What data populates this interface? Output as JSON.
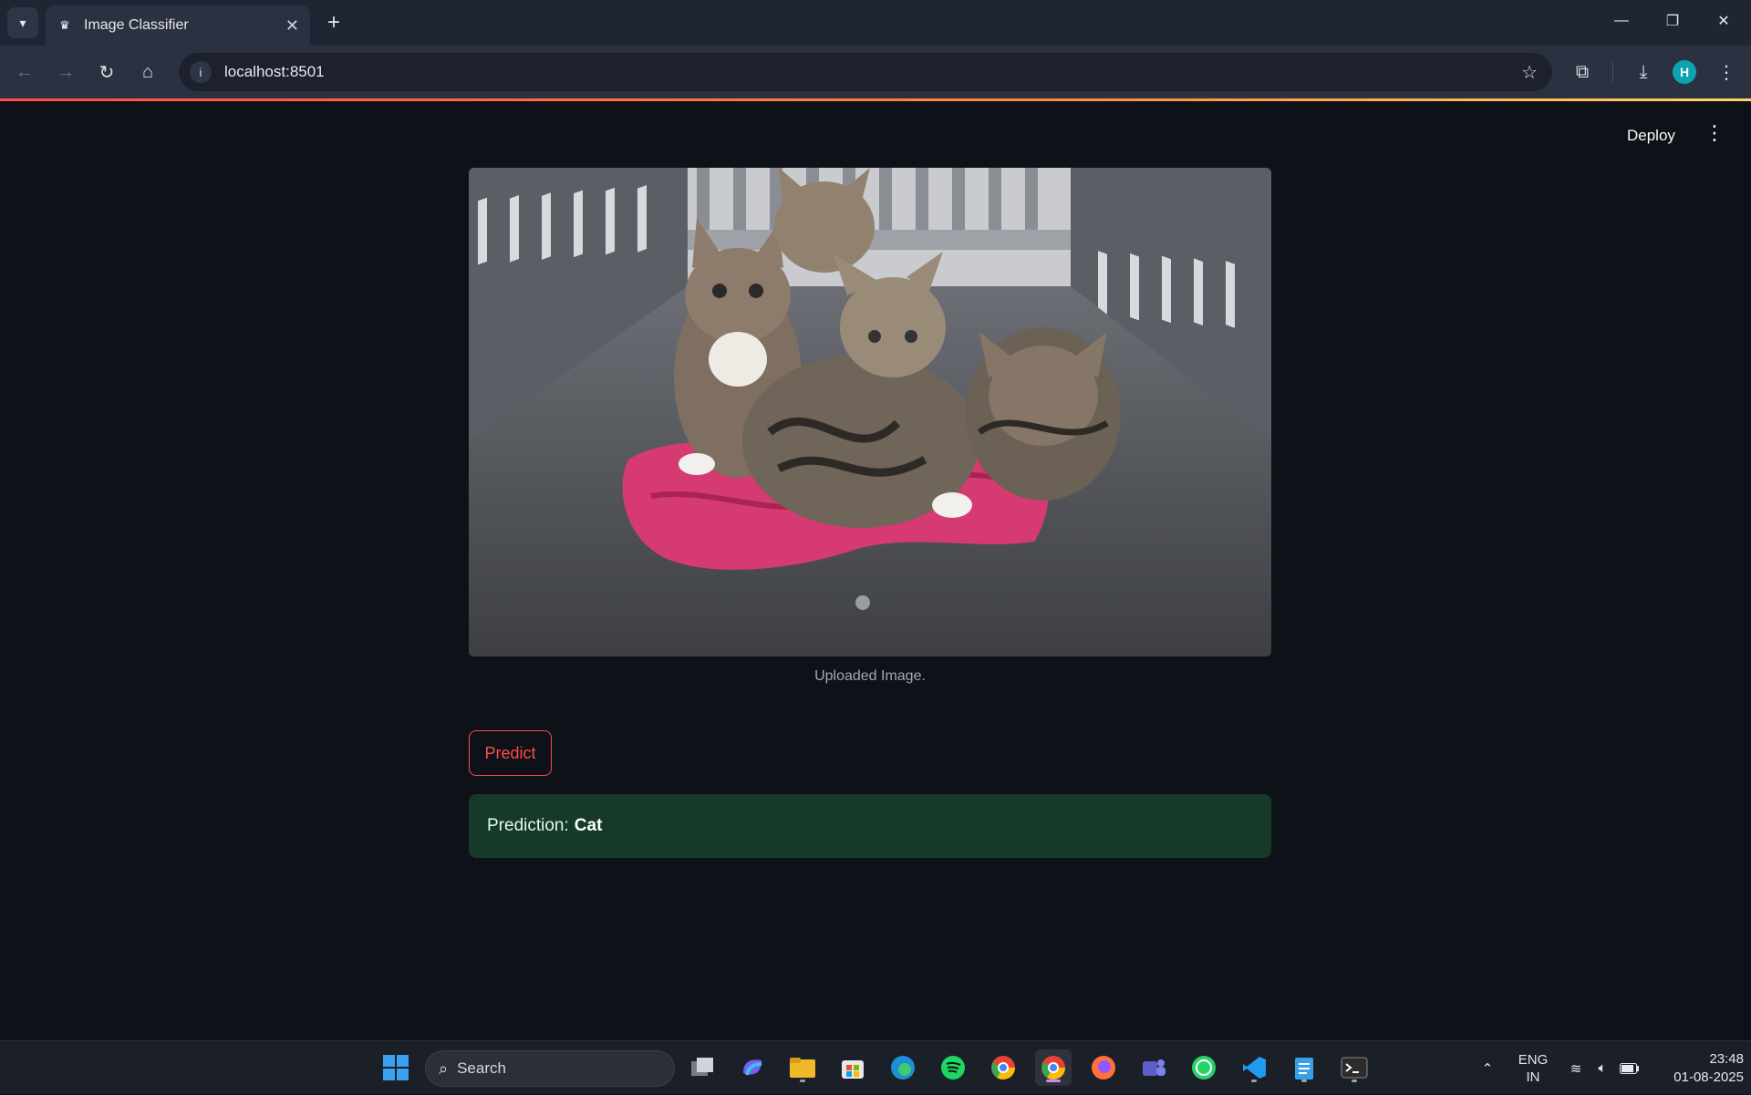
{
  "browser": {
    "tab_title": "Image Classifier",
    "url": "localhost:8501",
    "profile_initial": "H"
  },
  "app": {
    "deploy_label": "Deploy",
    "image_caption": "Uploaded Image.",
    "predict_label": "Predict",
    "result_prefix": "Prediction:",
    "result_value": "Cat",
    "accent_color": "#ff4b4b",
    "success_bg": "#173928"
  },
  "taskbar": {
    "search_placeholder": "Search",
    "language_top": "ENG",
    "language_bottom": "IN",
    "time": "23:48",
    "date": "01-08-2025",
    "apps": [
      "start-icon",
      "task-view-icon",
      "copilot-icon",
      "file-explorer-icon",
      "store-icon",
      "edge-icon",
      "spotify-icon",
      "chrome-profile-icon",
      "chrome-active-icon",
      "firefox-icon",
      "teams-icon",
      "whatsapp-icon",
      "vscode-icon",
      "notepad-icon",
      "terminal-icon"
    ]
  }
}
